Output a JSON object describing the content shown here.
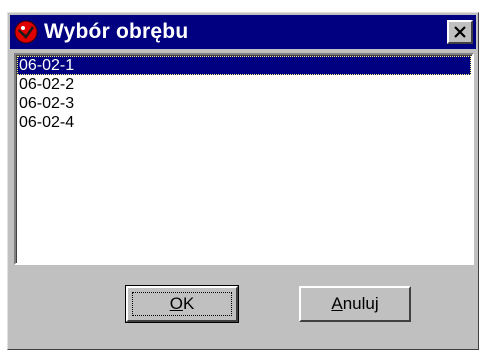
{
  "window": {
    "title": "Wybór obrębu",
    "icon": "red-circle-app-icon",
    "close_icon": "close-icon"
  },
  "list": {
    "items": [
      {
        "label": "06-02-1",
        "selected": true
      },
      {
        "label": "06-02-2",
        "selected": false
      },
      {
        "label": "06-02-3",
        "selected": false
      },
      {
        "label": "06-02-4",
        "selected": false
      }
    ]
  },
  "buttons": {
    "ok": {
      "accel": "O",
      "rest": "K"
    },
    "cancel": {
      "accel": "A",
      "rest": "nuluj"
    }
  },
  "colors": {
    "titlebar": "#000080",
    "face": "#c0c0c0",
    "selection": "#000080",
    "icon_red": "#e00000"
  }
}
